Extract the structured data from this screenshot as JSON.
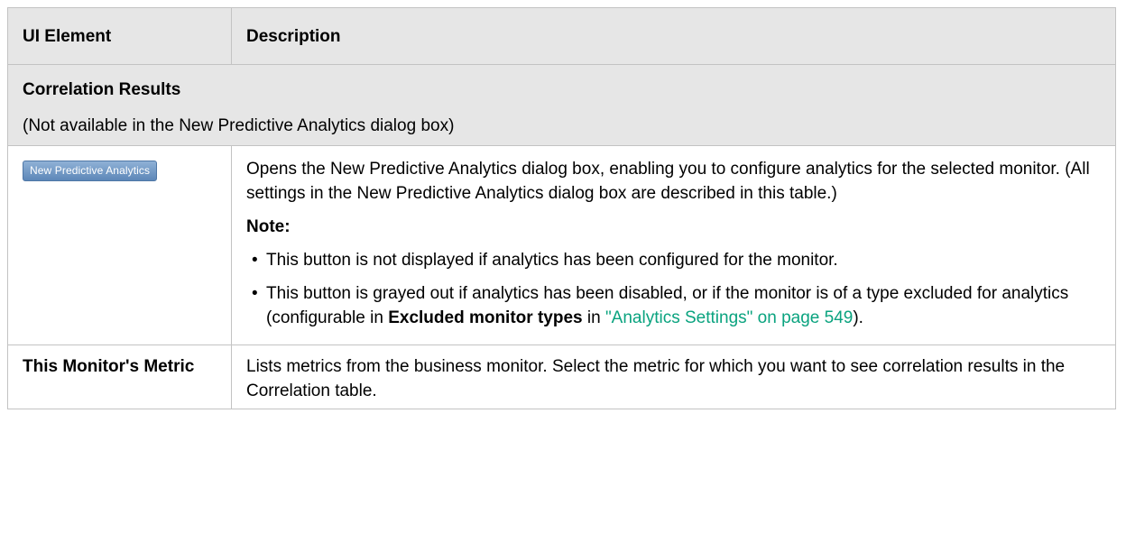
{
  "header": {
    "col1": "UI Element",
    "col2": "Description"
  },
  "section": {
    "title": "Correlation Results",
    "subtitle": "(Not available in the New Predictive Analytics dialog box)"
  },
  "rows": [
    {
      "button_label": "New Predictive Analytics",
      "description": "Opens the New Predictive Analytics dialog box, enabling you to configure analytics for the selected monitor. (All settings in the New Predictive Analytics dialog box are described in this table.)",
      "note_label": "Note:",
      "bullet1": "This button is not displayed if analytics has been configured for the monitor.",
      "bullet2_pre": "This button is grayed out if analytics has been disabled, or if the monitor is of a type excluded for analytics (configurable in ",
      "bullet2_bold": "Excluded monitor types",
      "bullet2_mid": " in ",
      "bullet2_link": "\"Analytics Settings\" on page 549",
      "bullet2_post": ")."
    },
    {
      "element": "This Monitor's Metric",
      "description": "Lists metrics from the business monitor. Select the metric for which you want to see correlation results in the Correlation table."
    }
  ],
  "colors": {
    "header_bg": "#e6e6e6",
    "border": "#c3c3c3",
    "link": "#0aa37f",
    "button": "#6b92c0"
  }
}
